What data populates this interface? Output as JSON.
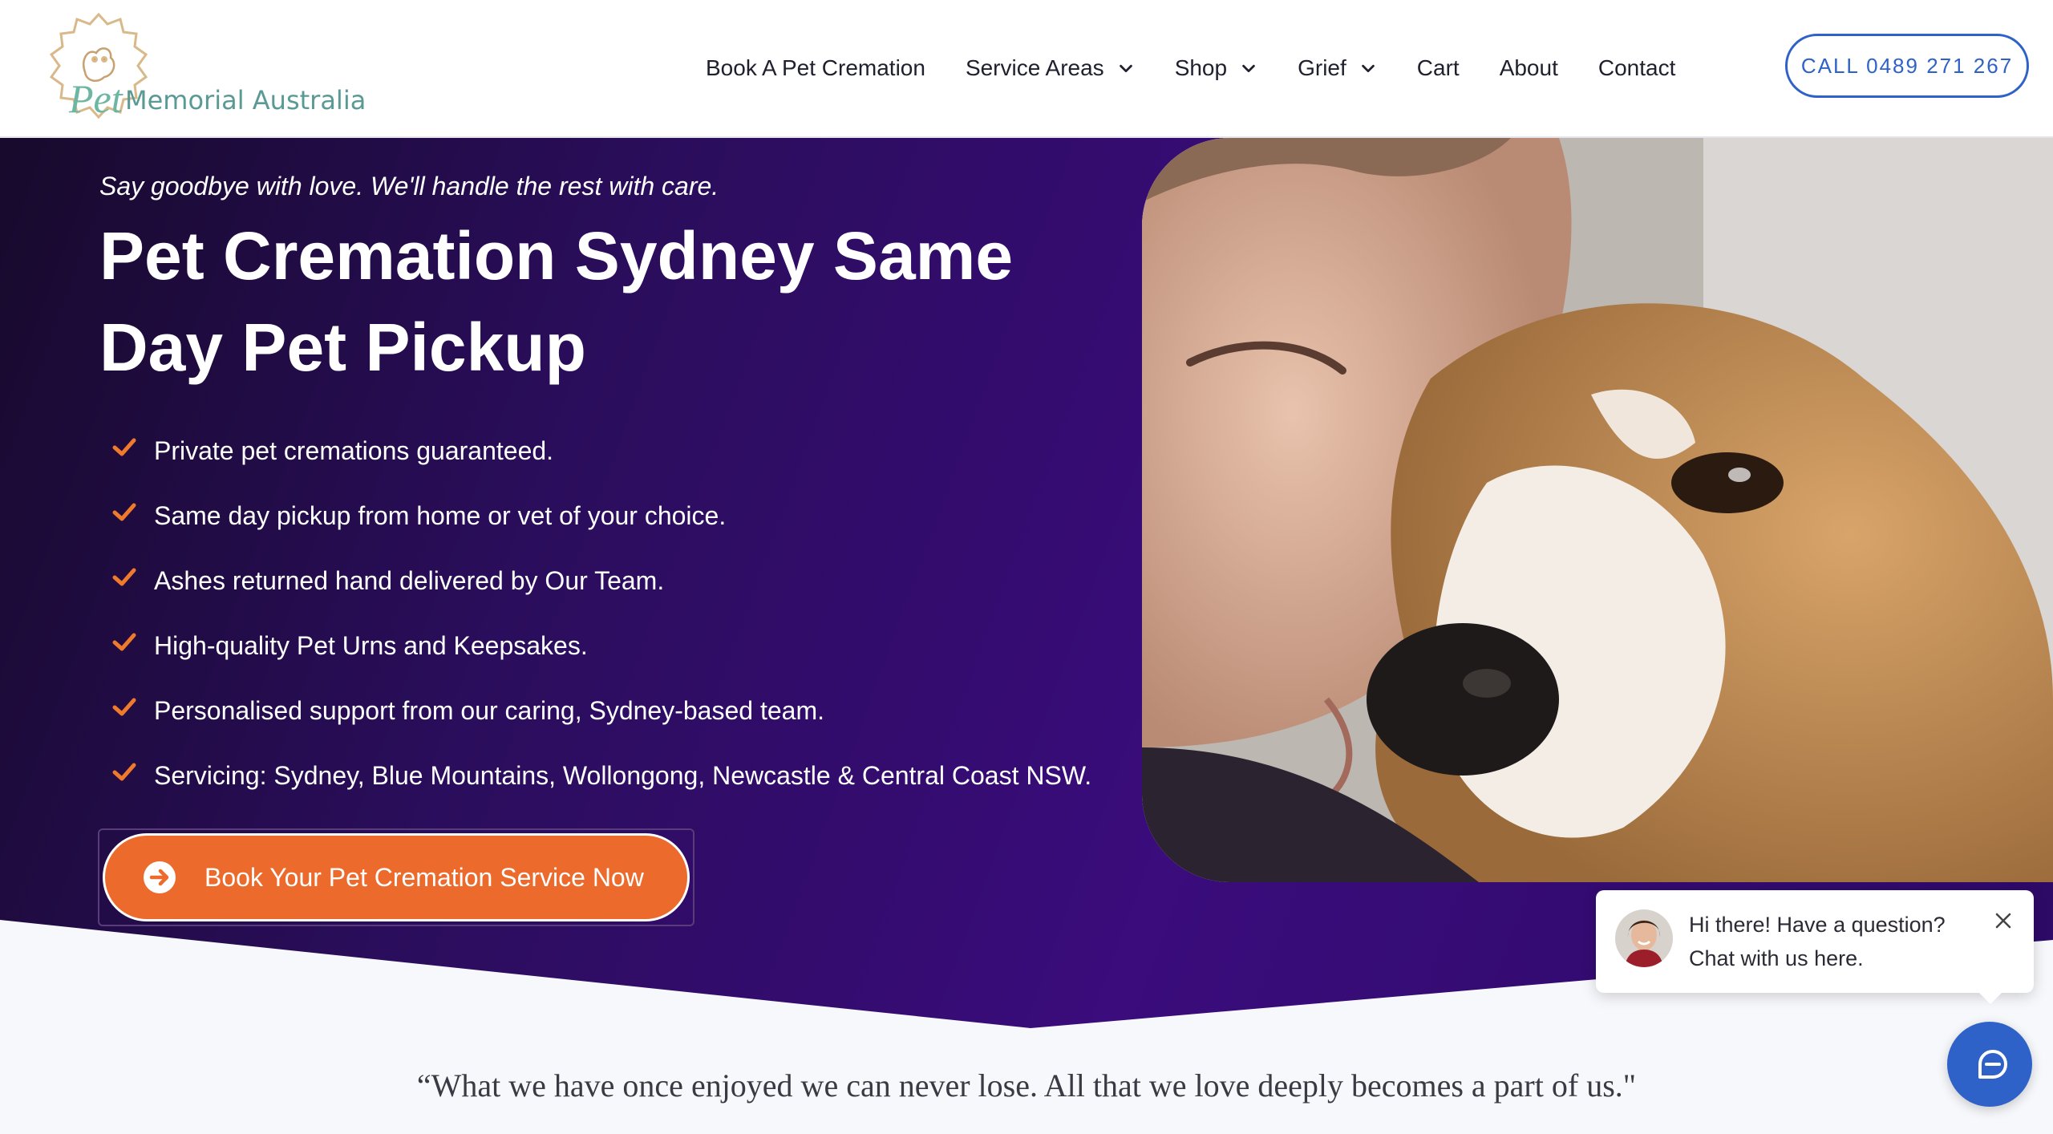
{
  "logo": {
    "word": "Pet",
    "rest": "Memorial Australia"
  },
  "nav": {
    "items": [
      {
        "label": "Book A Pet Cremation",
        "dropdown": false
      },
      {
        "label": "Service Areas",
        "dropdown": true
      },
      {
        "label": "Shop",
        "dropdown": true
      },
      {
        "label": "Grief",
        "dropdown": true
      },
      {
        "label": "Cart",
        "dropdown": false
      },
      {
        "label": "About",
        "dropdown": false
      },
      {
        "label": "Contact",
        "dropdown": false
      }
    ],
    "call_label": "CALL 0489 271 267"
  },
  "hero": {
    "tagline": "Say goodbye with love. We'll handle the rest with care.",
    "title": "Pet Cremation Sydney Same Day Pet Pickup",
    "features": [
      "Private pet cremations guaranteed.",
      "Same day pickup from home or vet of your choice.",
      "Ashes returned hand delivered by Our Team.",
      "High-quality Pet Urns and Keepsakes.",
      "Personalised support from our caring, Sydney-based team.",
      "Servicing: Sydney, Blue Mountains, Wollongong, Newcastle & Central Coast NSW."
    ],
    "cta_label": "Book Your Pet Cremation Service Now"
  },
  "quote": "“What we have once enjoyed we can never lose. All that we love deeply becomes a part of us.\"",
  "chat": {
    "line1": "Hi there! Have a question?",
    "line2": "Chat with us here."
  },
  "colors": {
    "accent_orange": "#ec6a2c",
    "brand_blue": "#2e62c9",
    "hero_purple": "#3a0c7c",
    "check_orange": "#f07a2c"
  },
  "icons": {
    "chevron": "chevron-down-icon",
    "check": "check-icon",
    "cta": "arrow-circle-icon",
    "close": "close-icon",
    "chat": "chat-icon"
  }
}
